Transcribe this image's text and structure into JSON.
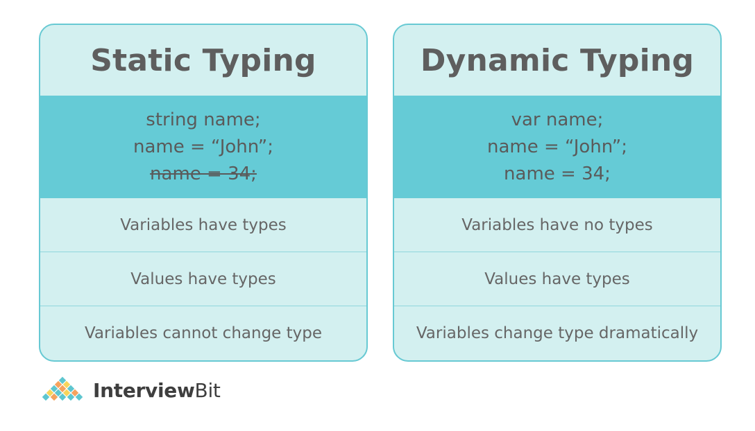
{
  "cards": [
    {
      "title": "Static Typing",
      "code": [
        {
          "text": "string name;",
          "struck": false
        },
        {
          "text": "name = “John”;",
          "struck": false
        },
        {
          "text": "name = 34;",
          "struck": true
        }
      ],
      "rows": [
        "Variables have types",
        "Values have types",
        "Variables cannot change type"
      ]
    },
    {
      "title": "Dynamic Typing",
      "code": [
        {
          "text": "var name;",
          "struck": false
        },
        {
          "text": "name = “John”;",
          "struck": false
        },
        {
          "text": "name = 34;",
          "struck": false
        }
      ],
      "rows": [
        "Variables have no types",
        "Values have types",
        "Variables change type dramatically"
      ]
    }
  ],
  "logo": {
    "bold_part": "Interview",
    "light_part": "Bit",
    "icon": "diamond-lattice-logo-icon"
  },
  "colors": {
    "header_bg": "#d3f0f0",
    "code_bg": "#65cbd6",
    "border": "#67c9d3",
    "text": "#616161",
    "logo_teal": "#5ec6cf",
    "logo_orange": "#f5a25d",
    "logo_yellow": "#f7d55c"
  }
}
